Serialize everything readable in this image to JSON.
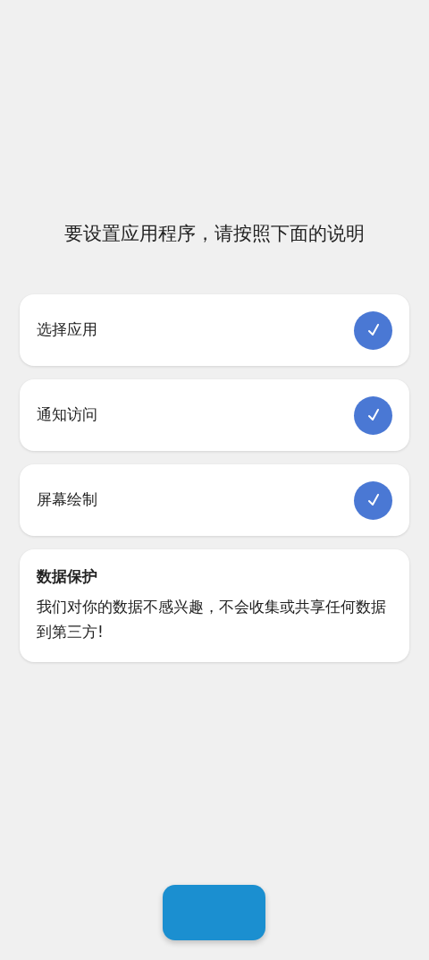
{
  "heading": "要设置应用程序，请按照下面的说明",
  "steps": [
    {
      "label": "选择应用",
      "checked": true
    },
    {
      "label": "通知访问",
      "checked": true
    },
    {
      "label": "屏幕绘制",
      "checked": true
    }
  ],
  "privacy": {
    "title": "数据保护",
    "body": "我们对你的数据不感兴趣，不会收集或共享任何数据到第三方!"
  }
}
